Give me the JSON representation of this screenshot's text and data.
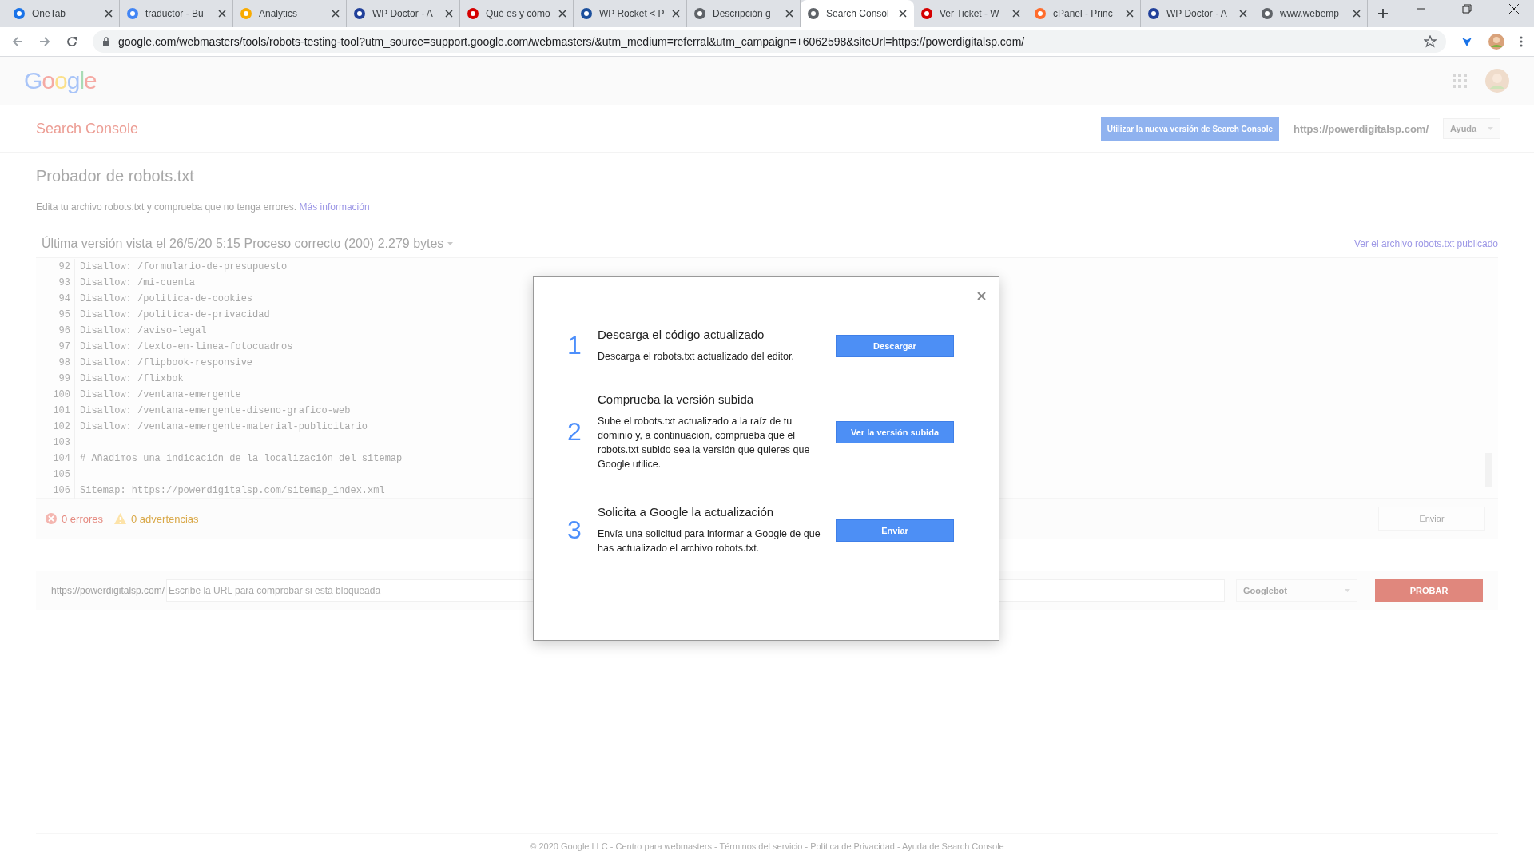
{
  "browser": {
    "tabs": [
      {
        "title": "OneTab",
        "selected": false
      },
      {
        "title": "traductor - Bu",
        "selected": false
      },
      {
        "title": "Analytics",
        "selected": false
      },
      {
        "title": "WP Doctor - A",
        "selected": false
      },
      {
        "title": "Qué es y cómo",
        "selected": false
      },
      {
        "title": "WP Rocket < P",
        "selected": false
      },
      {
        "title": "Descripción g",
        "selected": false
      },
      {
        "title": "Search Consol",
        "selected": true
      },
      {
        "title": "Ver Ticket - W",
        "selected": false
      },
      {
        "title": "cPanel - Princ",
        "selected": false
      },
      {
        "title": "WP Doctor - A",
        "selected": false
      },
      {
        "title": "www.webemp",
        "selected": false
      }
    ],
    "url": "google.com/webmasters/tools/robots-testing-tool?utm_source=support.google.com/webmasters/&utm_medium=referral&utm_campaign=+6062598&siteUrl=https://powerdigitalsp.com/"
  },
  "header": {
    "logo": "Google"
  },
  "console_bar": {
    "product": "Search Console",
    "new_version_button": "Utilizar la nueva versión de Search Console",
    "site": "https://powerdigitalsp.com/",
    "help": "Ayuda"
  },
  "page": {
    "title": "Probador de robots.txt",
    "description": "Edita tu archivo robots.txt y comprueba que no tenga errores.",
    "more_link": "Más información",
    "version": "Última versión vista el 26/5/20 5:15 Proceso correcto (200) 2.279 bytes",
    "published_link": "Ver el archivo robots.txt publicado"
  },
  "editor": {
    "lines": [
      {
        "number": "92",
        "text": "Disallow: /formulario-de-presupuesto"
      },
      {
        "number": "93",
        "text": "Disallow: /mi-cuenta"
      },
      {
        "number": "94",
        "text": "Disallow: /politica-de-cookies"
      },
      {
        "number": "95",
        "text": "Disallow: /politica-de-privacidad"
      },
      {
        "number": "96",
        "text": "Disallow: /aviso-legal"
      },
      {
        "number": "97",
        "text": "Disallow: /texto-en-linea-fotocuadros"
      },
      {
        "number": "98",
        "text": "Disallow: /flipbook-responsive"
      },
      {
        "number": "99",
        "text": "Disallow: /flixbok"
      },
      {
        "number": "100",
        "text": "Disallow: /ventana-emergente"
      },
      {
        "number": "101",
        "text": "Disallow: /ventana-emergente-diseno-grafico-web"
      },
      {
        "number": "102",
        "text": "Disallow: /ventana-emergente-material-publicitario"
      },
      {
        "number": "103"
      },
      {
        "number": "104",
        "text": "# Añadimos una indicación de la localización del sitemap"
      },
      {
        "number": "105"
      },
      {
        "number": "106",
        "text": "Sitemap: https://powerdigitalsp.com/sitemap_index.xml"
      }
    ],
    "errors": "0 errores",
    "warnings": "0 advertencias",
    "submit": "Enviar"
  },
  "tester": {
    "prefix": "https://powerdigitalsp.com/",
    "placeholder": "Escribe la URL para comprobar si está bloqueada",
    "agent": "Googlebot",
    "button": "PROBAR"
  },
  "footer": "© 2020 Google LLC - Centro para webmasters - Términos del servicio - Política de Privacidad - Ayuda de Search Console",
  "dialog": {
    "steps": [
      {
        "number": "1",
        "title": "Descarga el código actualizado",
        "text": "Descarga el robots.txt actualizado del editor.",
        "button": "Descargar"
      },
      {
        "number": "2",
        "title": "Comprueba la versión subida",
        "text": "Sube el robots.txt actualizado a la raíz de tu dominio y, a continuación, comprueba que el robots.txt subido sea la versión que quieres que Google utilice.",
        "button": "Ver la versión subida"
      },
      {
        "number": "3",
        "title": "Solicita a Google la actualización",
        "text": "Envía una solicitud para informar a Google de que has actualizado el archivo robots.txt.",
        "button": "Enviar"
      }
    ]
  }
}
